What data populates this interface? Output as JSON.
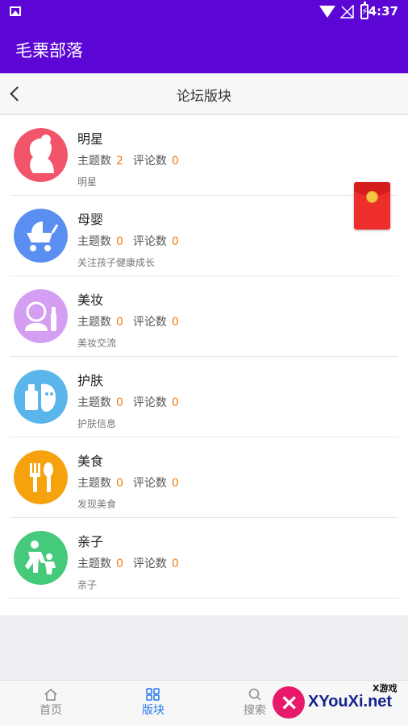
{
  "status_bar": {
    "time": "4:37"
  },
  "app_bar": {
    "title": "毛栗部落"
  },
  "nav_bar": {
    "title": "论坛版块"
  },
  "labels": {
    "topics": "主题数",
    "comments": "评论数"
  },
  "forums": [
    {
      "name": "明星",
      "topics": "2",
      "comments": "0",
      "desc": "明星",
      "icon": "celebrity-icon",
      "color": "#f2546a"
    },
    {
      "name": "母婴",
      "topics": "0",
      "comments": "0",
      "desc": "关注孩子健康成长",
      "icon": "stroller-icon",
      "color": "#5a8ef0"
    },
    {
      "name": "美妆",
      "topics": "0",
      "comments": "0",
      "desc": "美妆交流",
      "icon": "makeup-icon",
      "color": "#d49ef2"
    },
    {
      "name": "护肤",
      "topics": "0",
      "comments": "0",
      "desc": "护肤信息",
      "icon": "skincare-icon",
      "color": "#5ab6ea"
    },
    {
      "name": "美食",
      "topics": "0",
      "comments": "0",
      "desc": "发现美食",
      "icon": "food-icon",
      "color": "#f5a20d"
    },
    {
      "name": "亲子",
      "topics": "0",
      "comments": "0",
      "desc": "亲子",
      "icon": "parent-child-icon",
      "color": "#45c97a"
    }
  ],
  "tabs": [
    {
      "label": "首页",
      "icon": "home-icon"
    },
    {
      "label": "版块",
      "icon": "grid-icon",
      "active": true
    },
    {
      "label": "搜索",
      "icon": "search-icon"
    }
  ],
  "watermark": {
    "small": "X游戏",
    "big": "XYouXi.net"
  },
  "colors": {
    "primary": "#5c06d6",
    "accent_number": "#ef7d12",
    "tab_active": "#2277ee"
  }
}
